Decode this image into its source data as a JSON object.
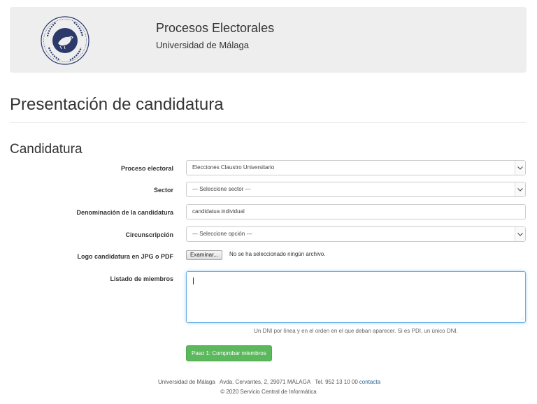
{
  "header": {
    "app_title": "Procesos Electorales",
    "app_subtitle": "Universidad de Málaga",
    "seal_text": "UNIVERSITAS MALACITANA",
    "seal_color": "#2b3a6b"
  },
  "page_title": "Presentación de candidatura",
  "section_title": "Candidatura",
  "form": {
    "proceso": {
      "label": "Proceso electoral",
      "value": "Elecciones Claustro Universitario"
    },
    "sector": {
      "label": "Sector",
      "value": "--- Seleccione sector ---"
    },
    "denominacion": {
      "label": "Denominación de la candidatura",
      "value": "candidatua individual"
    },
    "circunscripcion": {
      "label": "Circunscripción",
      "value": "--- Seleccione opción ---"
    },
    "logo": {
      "label": "Logo candidatura en JPG o PDF",
      "button": "Examinar...",
      "status": "No se ha seleccionado ningún archivo."
    },
    "miembros": {
      "label": "Listado de miembros",
      "value": "",
      "help": "Un DNI por línea y en el orden en el que deban aparecer. Si es PDI, un único DNI."
    },
    "submit": "Paso 1: Comprobar miembros"
  },
  "footer": {
    "org": "Universidad de Málaga",
    "address": "Avda. Cervantes, 2, 29071 MÁLAGA",
    "phone": "Tel. 952 13 10 00",
    "contact_link": "contacta",
    "copyright": "© 2020 Servicio Central de Informática"
  },
  "colors": {
    "header_bg": "#eeeeee",
    "button_green": "#5cb85c",
    "focus_blue": "#66afe9",
    "link": "#2a6496"
  }
}
